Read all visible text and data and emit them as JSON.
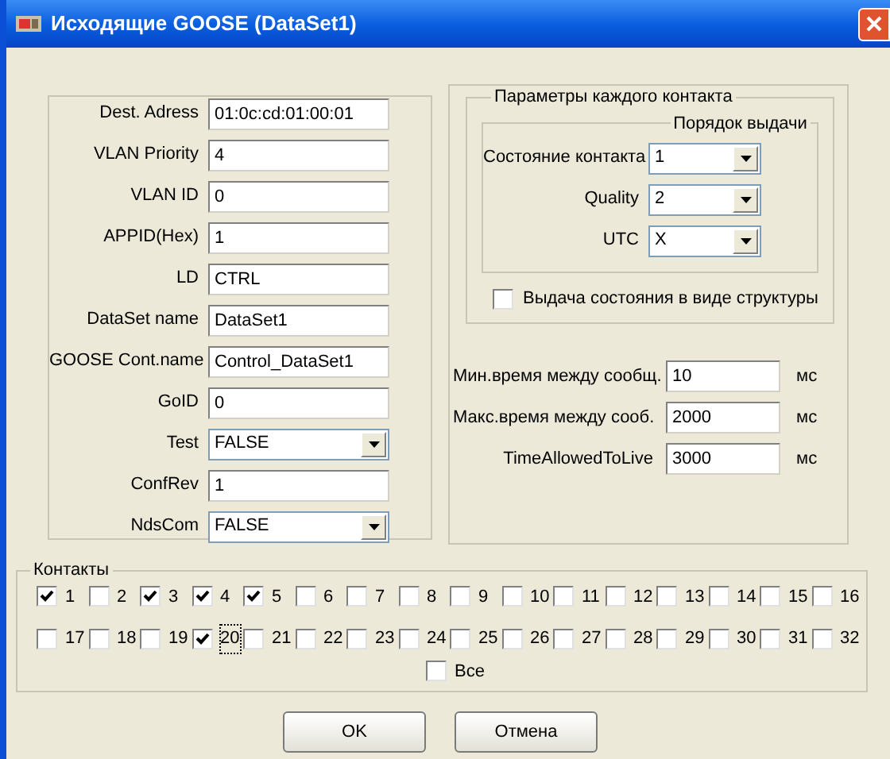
{
  "window": {
    "title": "Исходящие GOOSE (DataSet1)"
  },
  "stream_fields": [
    {
      "label": "Dest. Adress",
      "kind": "text",
      "value": "01:0c:cd:01:00:01"
    },
    {
      "label": "VLAN Priority",
      "kind": "text",
      "value": "4"
    },
    {
      "label": "VLAN ID",
      "kind": "text",
      "value": "0"
    },
    {
      "label": "APPID(Hex)",
      "kind": "text",
      "value": "1"
    },
    {
      "label": "LD",
      "kind": "text",
      "value": "CTRL"
    },
    {
      "label": "DataSet name",
      "kind": "text",
      "value": "DataSet1"
    },
    {
      "label": "GOOSE Cont.name",
      "kind": "text",
      "value": "Control_DataSet1"
    },
    {
      "label": "GoID",
      "kind": "text",
      "value": "0"
    },
    {
      "label": "Test",
      "kind": "dropdown",
      "value": "FALSE"
    },
    {
      "label": "ConfRev",
      "kind": "text",
      "value": "1"
    },
    {
      "label": "NdsCom",
      "kind": "dropdown",
      "value": "FALSE"
    }
  ],
  "contact_params": {
    "title": "Параметры каждого контакта",
    "order": {
      "title": "Порядок выдачи",
      "fields": [
        {
          "label": "Состояние контакта",
          "value": "1"
        },
        {
          "label": "Quality",
          "value": "2"
        },
        {
          "label": "UTC",
          "value": "X"
        }
      ]
    },
    "structure_checkbox": {
      "label": "Выдача состояния в виде структуры",
      "checked": false
    }
  },
  "timing_fields": [
    {
      "label": "Мин.время между сообщ.",
      "value": "10",
      "unit": "мс"
    },
    {
      "label": "Макс.время между сооб.",
      "value": "2000",
      "unit": "мс"
    },
    {
      "label": "TimeAllowedToLive",
      "value": "3000",
      "unit": "мс"
    }
  ],
  "contacts": {
    "title": "Контакты",
    "items": [
      {
        "label": "1",
        "checked": true,
        "focused": false
      },
      {
        "label": "2",
        "checked": false,
        "focused": false
      },
      {
        "label": "3",
        "checked": true,
        "focused": false
      },
      {
        "label": "4",
        "checked": true,
        "focused": false
      },
      {
        "label": "5",
        "checked": true,
        "focused": false
      },
      {
        "label": "6",
        "checked": false,
        "focused": false
      },
      {
        "label": "7",
        "checked": false,
        "focused": false
      },
      {
        "label": "8",
        "checked": false,
        "focused": false
      },
      {
        "label": "9",
        "checked": false,
        "focused": false
      },
      {
        "label": "10",
        "checked": false,
        "focused": false
      },
      {
        "label": "11",
        "checked": false,
        "focused": false
      },
      {
        "label": "12",
        "checked": false,
        "focused": false
      },
      {
        "label": "13",
        "checked": false,
        "focused": false
      },
      {
        "label": "14",
        "checked": false,
        "focused": false
      },
      {
        "label": "15",
        "checked": false,
        "focused": false
      },
      {
        "label": "16",
        "checked": false,
        "focused": false
      },
      {
        "label": "17",
        "checked": false,
        "focused": false
      },
      {
        "label": "18",
        "checked": false,
        "focused": false
      },
      {
        "label": "19",
        "checked": false,
        "focused": false
      },
      {
        "label": "20",
        "checked": true,
        "focused": true
      },
      {
        "label": "21",
        "checked": false,
        "focused": false
      },
      {
        "label": "22",
        "checked": false,
        "focused": false
      },
      {
        "label": "23",
        "checked": false,
        "focused": false
      },
      {
        "label": "24",
        "checked": false,
        "focused": false
      },
      {
        "label": "25",
        "checked": false,
        "focused": false
      },
      {
        "label": "26",
        "checked": false,
        "focused": false
      },
      {
        "label": "27",
        "checked": false,
        "focused": false
      },
      {
        "label": "28",
        "checked": false,
        "focused": false
      },
      {
        "label": "29",
        "checked": false,
        "focused": false
      },
      {
        "label": "30",
        "checked": false,
        "focused": false
      },
      {
        "label": "31",
        "checked": false,
        "focused": false
      },
      {
        "label": "32",
        "checked": false,
        "focused": false
      }
    ],
    "all": {
      "label": "Все",
      "checked": false
    }
  },
  "buttons": [
    {
      "label": "OK"
    },
    {
      "label": "Отмена"
    }
  ]
}
